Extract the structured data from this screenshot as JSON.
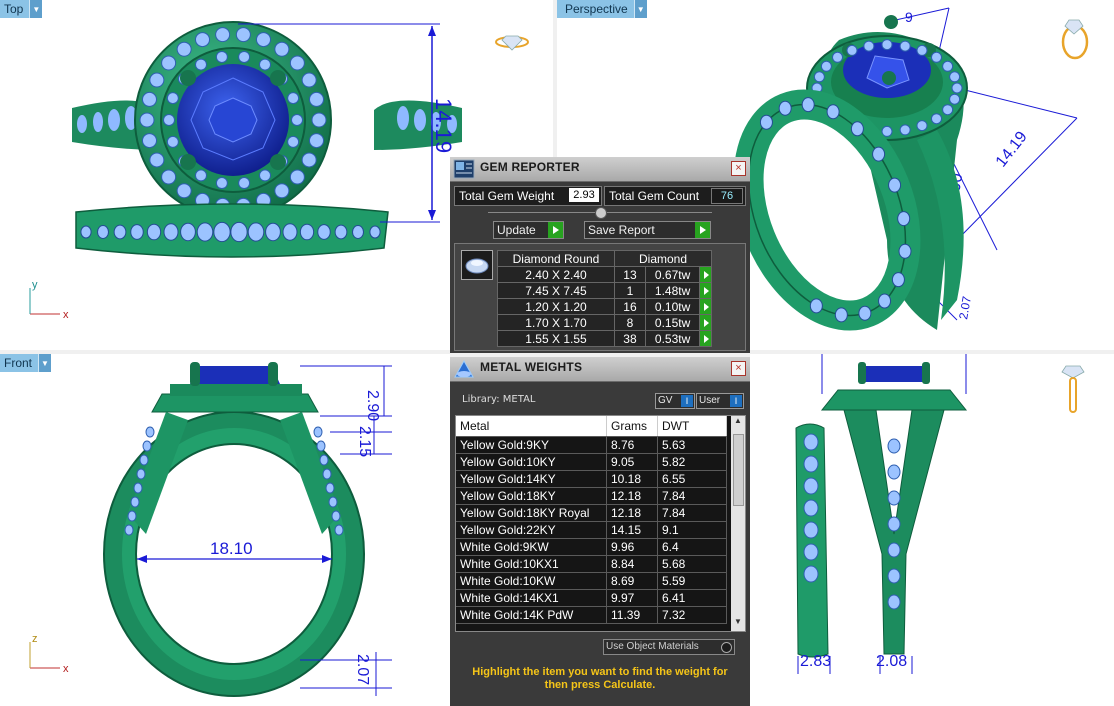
{
  "viewports": {
    "top": {
      "label": "Top",
      "dimension": "14.19",
      "axis_up": "y",
      "axis_right": "x"
    },
    "perspective": {
      "label": "Perspective",
      "dimensions": [
        "9",
        "14.19",
        "2.90",
        "2.07"
      ]
    },
    "front": {
      "label": "Front",
      "dimensions": {
        "width": "18.10",
        "height_a": "2.90",
        "height_b": "2.15",
        "band": "2.07"
      },
      "axis_up": "z",
      "axis_right": "x"
    },
    "right": {
      "dimensions": {
        "left": "2.83",
        "right": "2.08"
      }
    }
  },
  "gem_reporter": {
    "title": "GEM REPORTER",
    "total_weight_label": "Total Gem Weight",
    "total_weight_value": "2.93",
    "total_count_label": "Total Gem Count",
    "total_count_value": "76",
    "update_label": "Update",
    "save_label": "Save Report",
    "table_header": {
      "shape": "Diamond Round",
      "type": "Diamond"
    },
    "rows": [
      {
        "size": "2.40 X 2.40",
        "count": "13",
        "weight": "0.67tw"
      },
      {
        "size": "7.45 X 7.45",
        "count": "1",
        "weight": "1.48tw"
      },
      {
        "size": "1.20 X 1.20",
        "count": "16",
        "weight": "0.10tw"
      },
      {
        "size": "1.70 X 1.70",
        "count": "8",
        "weight": "0.15tw"
      },
      {
        "size": "1.55 X 1.55",
        "count": "38",
        "weight": "0.53tw"
      }
    ]
  },
  "metal_weights": {
    "title": "METAL WEIGHTS",
    "library_label": "Library: METAL",
    "gv_label": "GV",
    "user_label": "User",
    "headers": {
      "metal": "Metal",
      "grams": "Grams",
      "dwt": "DWT"
    },
    "rows": [
      {
        "metal": "Yellow Gold:9KY",
        "grams": "8.76",
        "dwt": "5.63"
      },
      {
        "metal": "Yellow Gold:10KY",
        "grams": "9.05",
        "dwt": "5.82"
      },
      {
        "metal": "Yellow Gold:14KY",
        "grams": "10.18",
        "dwt": "6.55"
      },
      {
        "metal": "Yellow Gold:18KY",
        "grams": "12.18",
        "dwt": "7.84"
      },
      {
        "metal": "Yellow Gold:18KY Royal",
        "grams": "12.18",
        "dwt": "7.84"
      },
      {
        "metal": "Yellow Gold:22KY",
        "grams": "14.15",
        "dwt": "9.1"
      },
      {
        "metal": "White Gold:9KW",
        "grams": "9.96",
        "dwt": "6.4"
      },
      {
        "metal": "White Gold:10KX1",
        "grams": "8.84",
        "dwt": "5.68"
      },
      {
        "metal": "White Gold:10KW",
        "grams": "8.69",
        "dwt": "5.59"
      },
      {
        "metal": "White Gold:14KX1",
        "grams": "9.97",
        "dwt": "6.41"
      },
      {
        "metal": "White Gold:14K PdW",
        "grams": "11.39",
        "dwt": "7.32"
      }
    ],
    "use_object_materials_label": "Use Object Materials",
    "hint": "Highlight the item you want to find the weight for then press Calculate."
  },
  "colors": {
    "metal": "#1e8c62",
    "gem": "#1b2fb8",
    "accent_stone": "#8fb9ff",
    "dimension": "#1a1ad6",
    "hint": "#f5c518",
    "viewport_tab": "#8bc3e6"
  }
}
